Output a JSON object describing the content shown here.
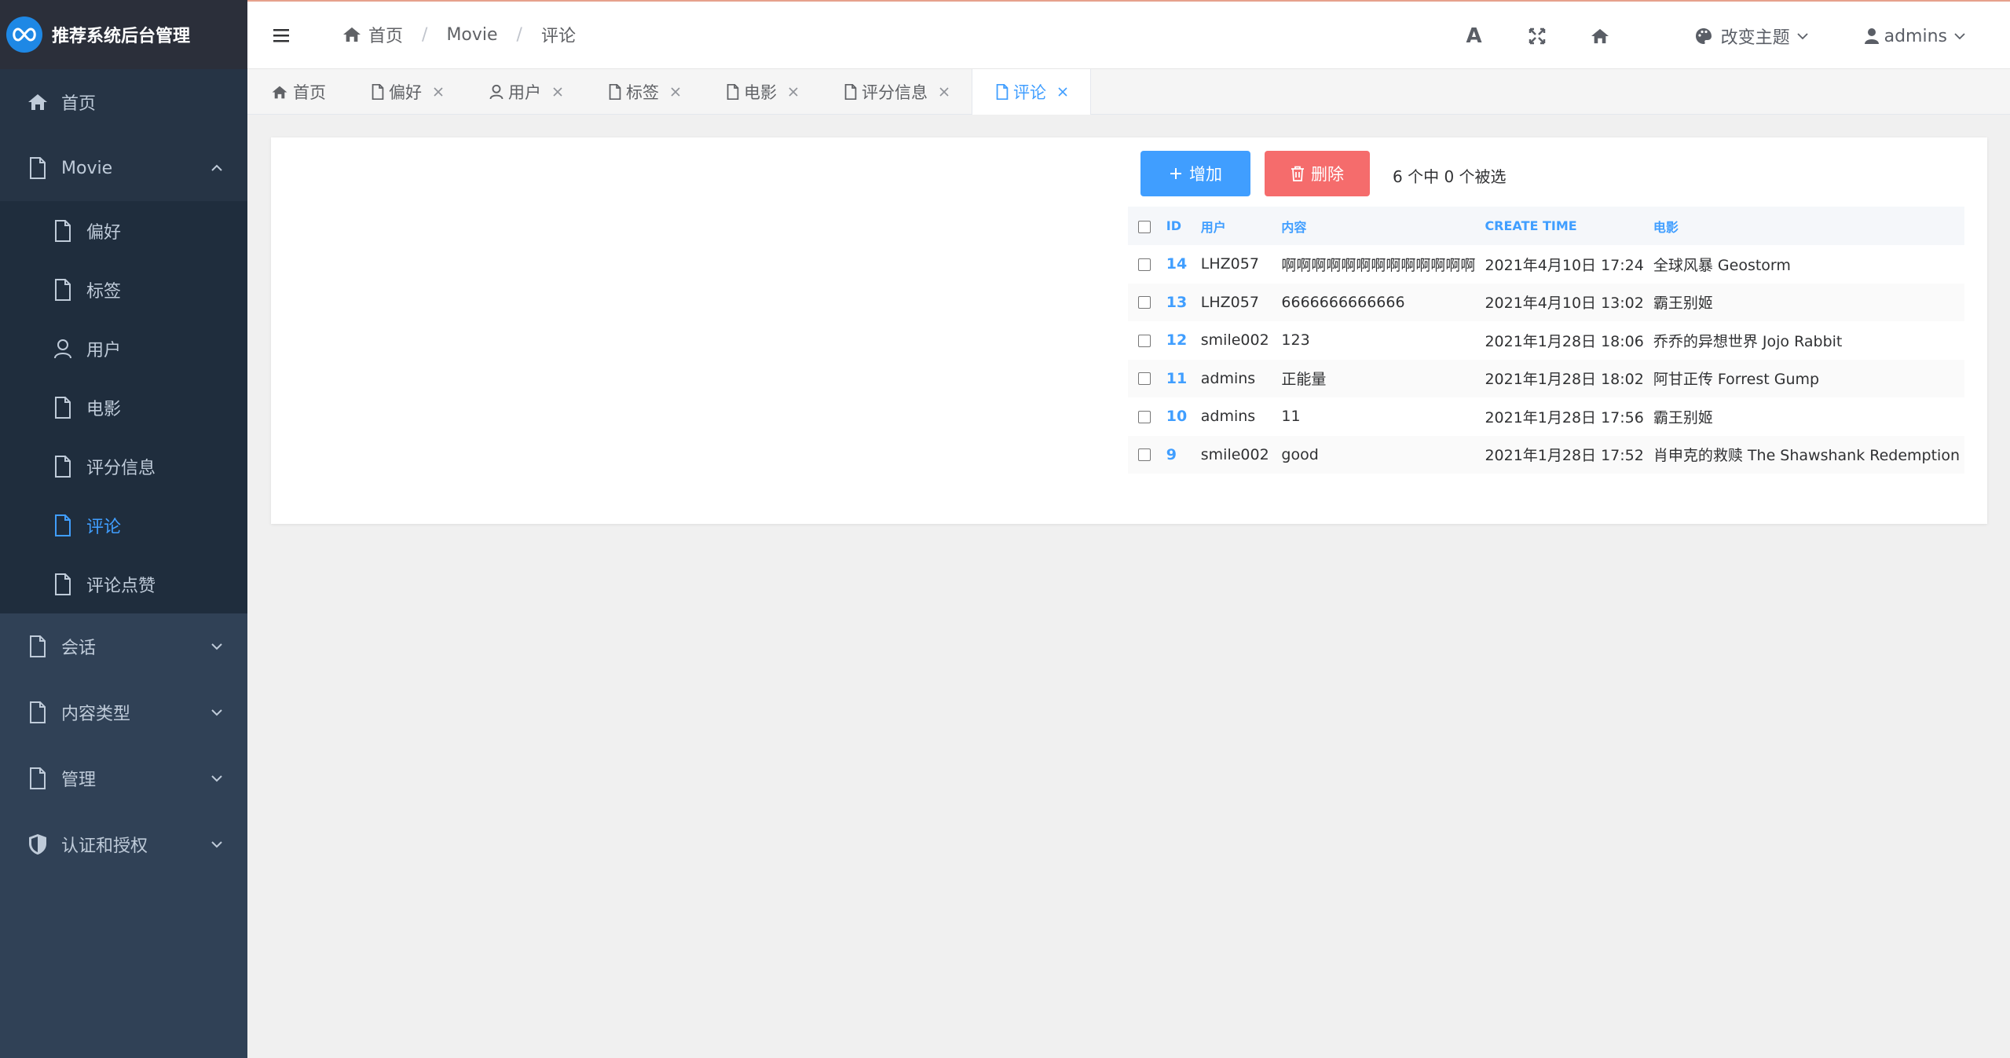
{
  "app": {
    "title": "推荐系统后台管理"
  },
  "sidebar": {
    "home": "首页",
    "movie": "Movie",
    "movie_items": [
      "偏好",
      "标签",
      "用户",
      "电影",
      "评分信息",
      "评论",
      "评论点赞"
    ],
    "session": "会话",
    "content_type": "内容类型",
    "admin": "管理",
    "auth": "认证和授权"
  },
  "breadcrumb": [
    "首页",
    "Movie",
    "评论"
  ],
  "toolbar": {
    "font_icon": "A",
    "theme_label": "改变主题",
    "user_name": "admins"
  },
  "tabs": [
    {
      "label": "首页",
      "icon": "home-icon",
      "closable": false,
      "active": false
    },
    {
      "label": "偏好",
      "icon": "file-icon",
      "closable": true,
      "active": false
    },
    {
      "label": "用户",
      "icon": "user-icon",
      "closable": true,
      "active": false
    },
    {
      "label": "标签",
      "icon": "file-icon",
      "closable": true,
      "active": false
    },
    {
      "label": "电影",
      "icon": "file-icon",
      "closable": true,
      "active": false
    },
    {
      "label": "评分信息",
      "icon": "file-icon",
      "closable": true,
      "active": false
    },
    {
      "label": "评论",
      "icon": "file-icon",
      "closable": true,
      "active": true
    }
  ],
  "actions": {
    "add": "增加",
    "delete": "删除",
    "selection": "6 个中 0 个被选"
  },
  "table": {
    "headers": [
      "ID",
      "用户",
      "内容",
      "CREATE TIME",
      "电影"
    ],
    "rows": [
      [
        "14",
        "LHZ057",
        "啊啊啊啊啊啊啊啊啊啊啊啊啊",
        "2021年4月10日 17:24",
        "全球风暴 Geostorm"
      ],
      [
        "13",
        "LHZ057",
        "6666666666666",
        "2021年4月10日 13:02",
        "霸王别姬"
      ],
      [
        "12",
        "smile002",
        "123",
        "2021年1月28日 18:06",
        "乔乔的异想世界 Jojo Rabbit"
      ],
      [
        "11",
        "admins",
        "正能量",
        "2021年1月28日 18:02",
        "阿甘正传 Forrest Gump"
      ],
      [
        "10",
        "admins",
        "11",
        "2021年1月28日 17:56",
        "霸王别姬"
      ],
      [
        "9",
        "smile002",
        "good",
        "2021年1月28日 17:52",
        "肖申克的救赎 The Shawshank Redemption"
      ]
    ]
  },
  "colors": {
    "accent": "#409eff",
    "danger": "#f56c6c",
    "sidebar_bg": "#304156"
  }
}
